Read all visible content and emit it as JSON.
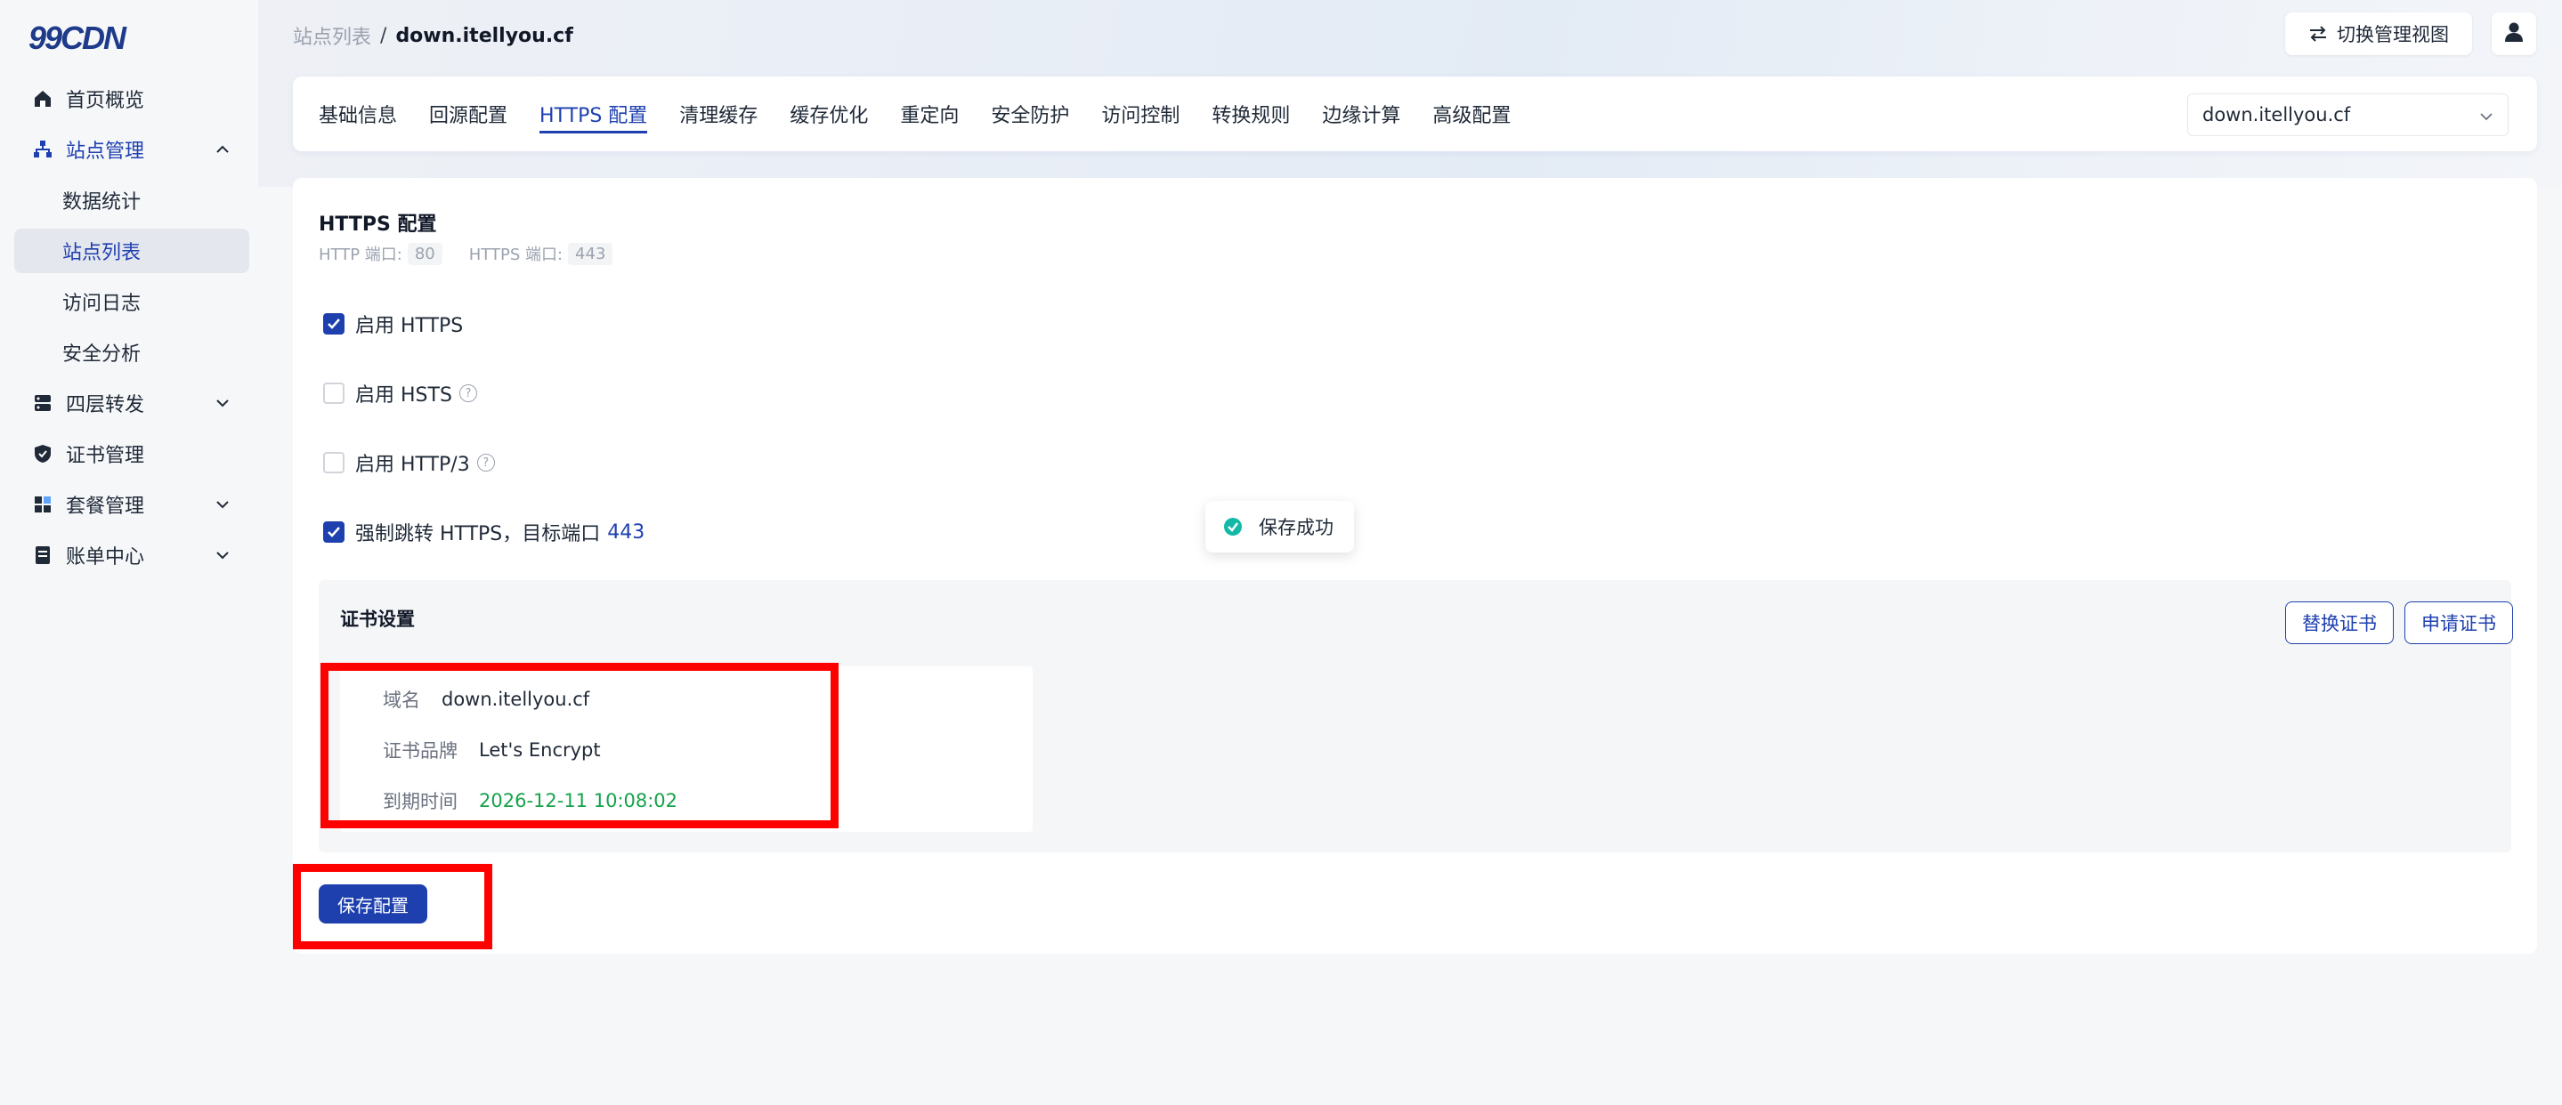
{
  "app": {
    "logo_text": "99CDN",
    "brand_color": "#1e40af",
    "accent_red": "#ff0000",
    "success_color": "#16a34a"
  },
  "sidebar": {
    "items": [
      {
        "label": "首页概览",
        "icon": "home-icon"
      },
      {
        "label": "站点管理",
        "icon": "sitemap-icon",
        "expanded": true
      },
      {
        "label": "数据统计"
      },
      {
        "label": "站点列表",
        "active": true
      },
      {
        "label": "访问日志"
      },
      {
        "label": "安全分析"
      },
      {
        "label": "四层转发",
        "icon": "server-icon"
      },
      {
        "label": "证书管理",
        "icon": "shield-icon"
      },
      {
        "label": "套餐管理",
        "icon": "apps-icon"
      },
      {
        "label": "账单中心",
        "icon": "bill-icon"
      }
    ]
  },
  "header": {
    "breadcrumb_parent": "站点列表",
    "breadcrumb_sep": "/",
    "breadcrumb_current": "down.itellyou.cf",
    "switch_view_label": "切换管理视图"
  },
  "tabs": [
    {
      "label": "基础信息"
    },
    {
      "label": "回源配置"
    },
    {
      "label": "HTTPS 配置",
      "active": true
    },
    {
      "label": "清理缓存"
    },
    {
      "label": "缓存优化"
    },
    {
      "label": "重定向"
    },
    {
      "label": "安全防护"
    },
    {
      "label": "访问控制"
    },
    {
      "label": "转换规则"
    },
    {
      "label": "边缘计算"
    },
    {
      "label": "高级配置"
    }
  ],
  "domain_select": {
    "value": "down.itellyou.cf"
  },
  "https": {
    "title": "HTTPS 配置",
    "http_port_label": "HTTP 端口:",
    "http_port": "80",
    "https_port_label": "HTTPS 端口:",
    "https_port": "443",
    "enable_https": {
      "label": "启用 HTTPS",
      "checked": true
    },
    "enable_hsts": {
      "label": "启用 HSTS",
      "checked": false
    },
    "enable_http3": {
      "label": "启用 HTTP/3",
      "checked": false
    },
    "force_redirect": {
      "label": "强制跳转 HTTPS，目标端口",
      "port": "443",
      "checked": true
    }
  },
  "cert": {
    "title": "证书设置",
    "replace_label": "替换证书",
    "apply_label": "申请证书",
    "domain_key": "域名",
    "domain_value": "down.itellyou.cf",
    "brand_key": "证书品牌",
    "brand_value": "Let's Encrypt",
    "expiry_key": "到期时间",
    "expiry_value": "2026-12-11 10:08:02"
  },
  "save_label": "保存配置",
  "toast": {
    "message": "保存成功"
  }
}
